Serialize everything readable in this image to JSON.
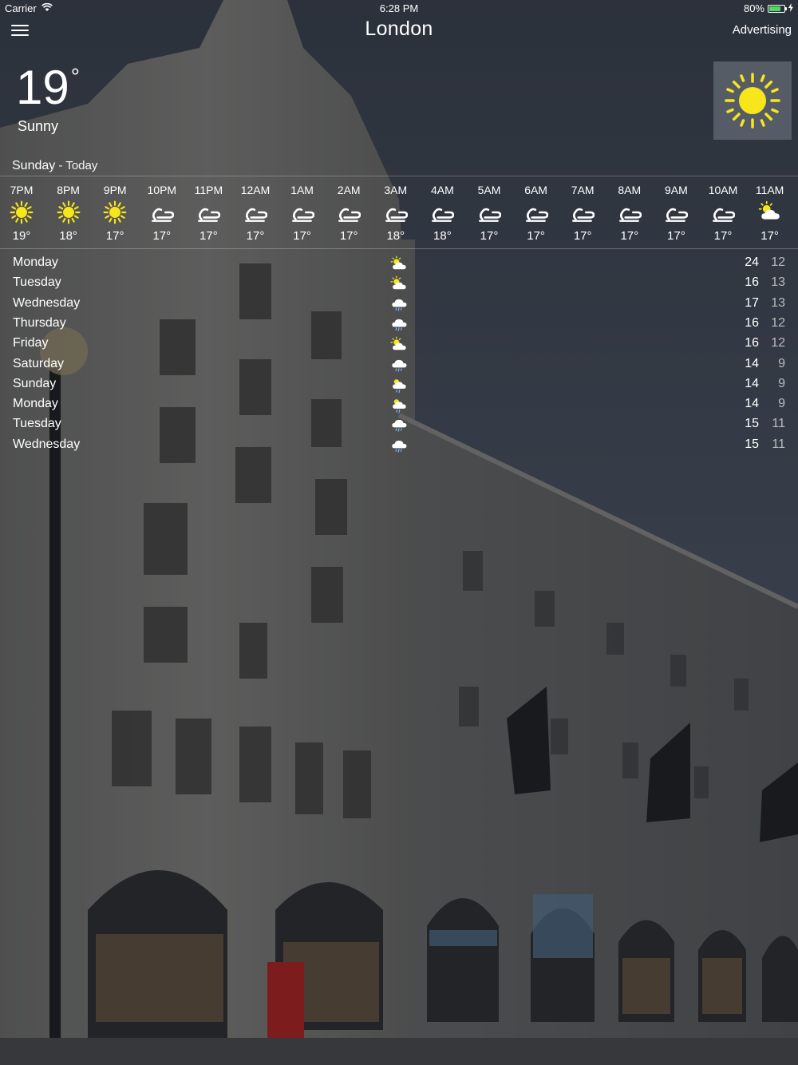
{
  "status_bar": {
    "carrier": "Carrier",
    "time": "6:28 PM",
    "battery": "80%",
    "battery_level": 0.8
  },
  "nav": {
    "city": "London",
    "advertising": "Advertising"
  },
  "current": {
    "temperature": "19",
    "degree": "°",
    "condition": "Sunny",
    "icon": "sun-icon"
  },
  "day_header": {
    "day": "Sunday",
    "separator": " - ",
    "today": "Today"
  },
  "hourly": [
    {
      "time": "7PM",
      "icon": "sun-icon",
      "temp": "19°"
    },
    {
      "time": "8PM",
      "icon": "sun-icon",
      "temp": "18°"
    },
    {
      "time": "9PM",
      "icon": "sun-icon",
      "temp": "17°"
    },
    {
      "time": "10PM",
      "icon": "wind-icon",
      "temp": "17°"
    },
    {
      "time": "11PM",
      "icon": "wind-icon",
      "temp": "17°"
    },
    {
      "time": "12AM",
      "icon": "wind-icon",
      "temp": "17°"
    },
    {
      "time": "1AM",
      "icon": "wind-icon",
      "temp": "17°"
    },
    {
      "time": "2AM",
      "icon": "wind-icon",
      "temp": "17°"
    },
    {
      "time": "3AM",
      "icon": "wind-icon",
      "temp": "18°"
    },
    {
      "time": "4AM",
      "icon": "wind-icon",
      "temp": "18°"
    },
    {
      "time": "5AM",
      "icon": "wind-icon",
      "temp": "17°"
    },
    {
      "time": "6AM",
      "icon": "wind-icon",
      "temp": "17°"
    },
    {
      "time": "7AM",
      "icon": "wind-icon",
      "temp": "17°"
    },
    {
      "time": "8AM",
      "icon": "wind-icon",
      "temp": "17°"
    },
    {
      "time": "9AM",
      "icon": "wind-icon",
      "temp": "17°"
    },
    {
      "time": "10AM",
      "icon": "wind-icon",
      "temp": "17°"
    },
    {
      "time": "11AM",
      "icon": "partly-cloudy-icon",
      "temp": "17°"
    }
  ],
  "daily": [
    {
      "day": "Monday",
      "icon": "partly-cloudy-icon",
      "high": "24",
      "low": "12"
    },
    {
      "day": "Tuesday",
      "icon": "partly-cloudy-icon",
      "high": "16",
      "low": "13"
    },
    {
      "day": "Wednesday",
      "icon": "rain-cloud-icon",
      "high": "17",
      "low": "13"
    },
    {
      "day": "Thursday",
      "icon": "rain-cloud-icon",
      "high": "16",
      "low": "12"
    },
    {
      "day": "Friday",
      "icon": "partly-cloudy-icon",
      "high": "16",
      "low": "12"
    },
    {
      "day": "Saturday",
      "icon": "rain-cloud-icon",
      "high": "14",
      "low": "9"
    },
    {
      "day": "Sunday",
      "icon": "partly-cloudy-rain-icon",
      "high": "14",
      "low": "9"
    },
    {
      "day": "Monday",
      "icon": "partly-cloudy-rain-icon",
      "high": "14",
      "low": "9"
    },
    {
      "day": "Tuesday",
      "icon": "rain-cloud-icon",
      "high": "15",
      "low": "11"
    },
    {
      "day": "Wednesday",
      "icon": "rain-cloud-icon",
      "high": "15",
      "low": "11"
    }
  ],
  "colors": {
    "sun": "#f7e61a",
    "battery": "#4cd964",
    "text": "#ffffff"
  }
}
